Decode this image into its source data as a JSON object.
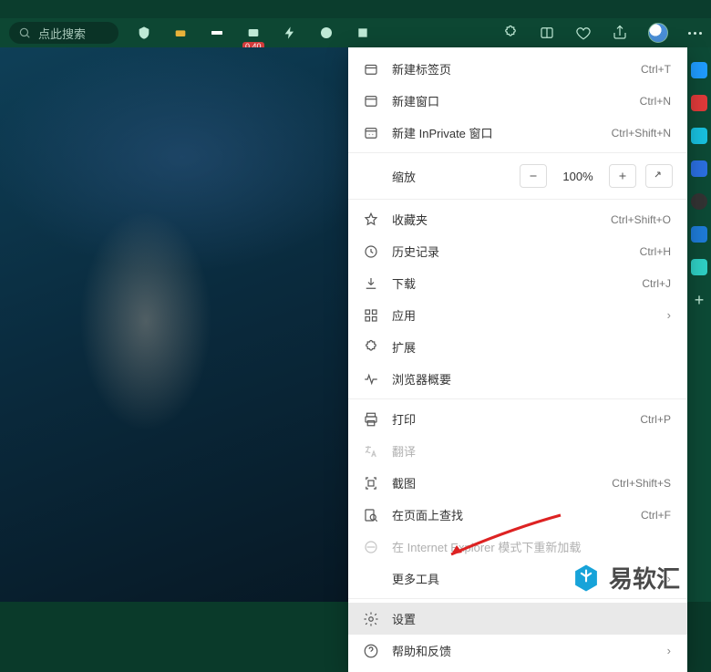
{
  "search": {
    "placeholder": "点此搜索"
  },
  "toolbar": {
    "badge": "0.40"
  },
  "menu": {
    "new_tab": {
      "label": "新建标签页",
      "shortcut": "Ctrl+T"
    },
    "new_window": {
      "label": "新建窗口",
      "shortcut": "Ctrl+N"
    },
    "new_inprivate": {
      "label": "新建 InPrivate 窗口",
      "shortcut": "Ctrl+Shift+N"
    },
    "zoom": {
      "label": "缩放",
      "value": "100%"
    },
    "favorites": {
      "label": "收藏夹",
      "shortcut": "Ctrl+Shift+O"
    },
    "history": {
      "label": "历史记录",
      "shortcut": "Ctrl+H"
    },
    "downloads": {
      "label": "下载",
      "shortcut": "Ctrl+J"
    },
    "apps": {
      "label": "应用"
    },
    "extensions": {
      "label": "扩展"
    },
    "essentials": {
      "label": "浏览器概要"
    },
    "print": {
      "label": "打印",
      "shortcut": "Ctrl+P"
    },
    "translate": {
      "label": "翻译"
    },
    "screenshot": {
      "label": "截图",
      "shortcut": "Ctrl+Shift+S"
    },
    "find": {
      "label": "在页面上查找",
      "shortcut": "Ctrl+F"
    },
    "ie_mode": {
      "label": "在 Internet Explorer 模式下重新加载"
    },
    "more_tools": {
      "label": "更多工具"
    },
    "settings": {
      "label": "设置"
    },
    "help": {
      "label": "帮助和反馈"
    }
  },
  "watermark": {
    "text": "易软汇"
  }
}
